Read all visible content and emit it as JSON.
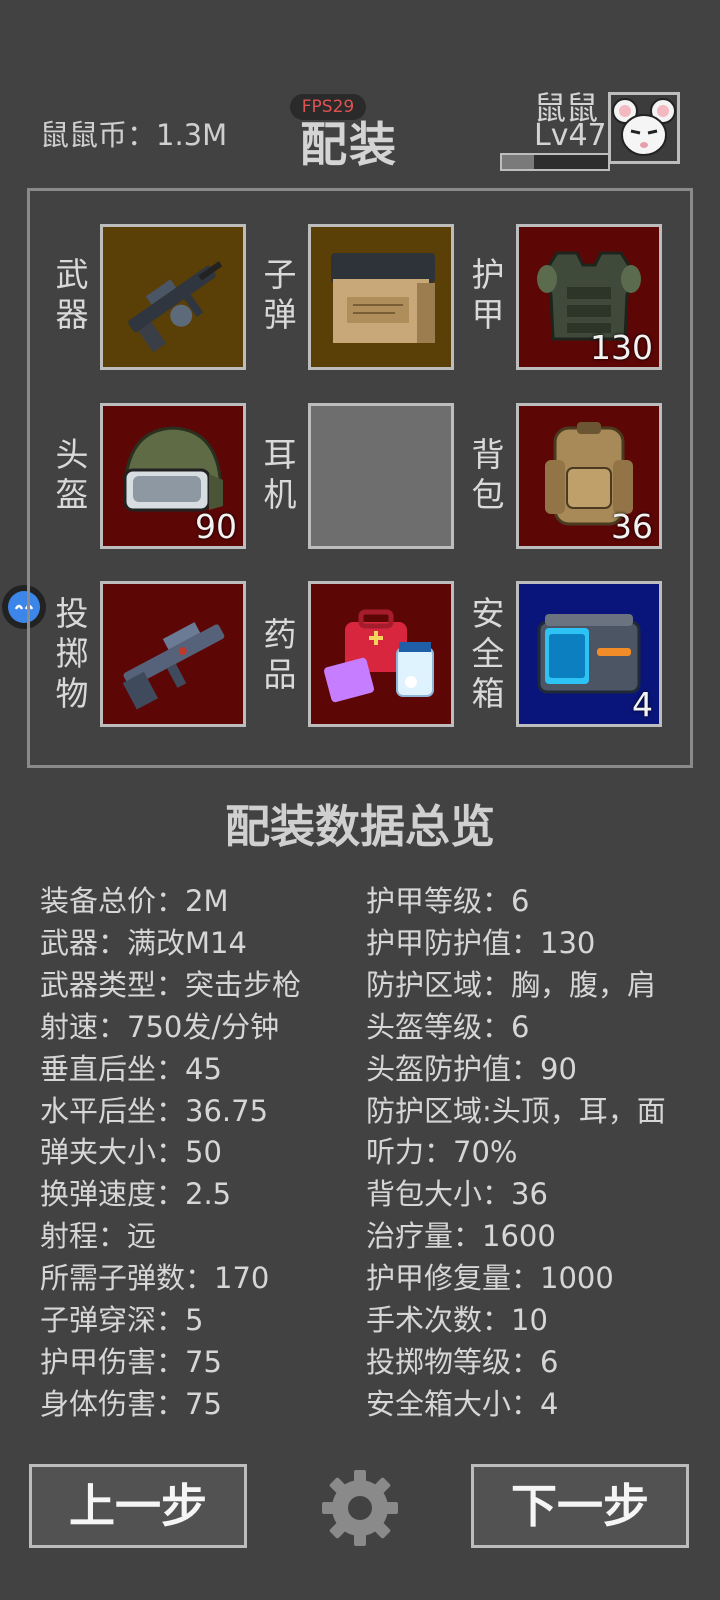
{
  "header": {
    "coins_label": "鼠鼠币：1.3M",
    "fps_label": "FPS29",
    "title": "配装",
    "user_name": "鼠鼠",
    "user_level": "Lv47",
    "xp_progress": 0.3
  },
  "slots": [
    {
      "label_chars": [
        "武",
        "器"
      ],
      "count": "",
      "bg": "#5a3f06",
      "icon": "rifle-icon"
    },
    {
      "label_chars": [
        "子",
        "弹"
      ],
      "count": "",
      "bg": "#5a3f06",
      "icon": "ammo-box-icon"
    },
    {
      "label_chars": [
        "护",
        "甲"
      ],
      "count": "130",
      "bg": "#5c0606",
      "icon": "armor-vest-icon"
    },
    {
      "label_chars": [
        "头",
        "盔"
      ],
      "count": "90",
      "bg": "#5c0606",
      "icon": "helmet-icon"
    },
    {
      "label_chars": [
        "耳",
        "机"
      ],
      "count": "",
      "bg": "#6e6e6e",
      "icon": "empty-slot"
    },
    {
      "label_chars": [
        "背",
        "包"
      ],
      "count": "36",
      "bg": "#5c0606",
      "icon": "backpack-icon"
    },
    {
      "label_chars": [
        "投",
        "掷",
        "物"
      ],
      "count": "",
      "bg": "#5c0606",
      "icon": "launcher-icon"
    },
    {
      "label_chars": [
        "药",
        "品"
      ],
      "count": "",
      "bg": "#5c0606",
      "icon": "medkit-icon"
    },
    {
      "label_chars": [
        "安",
        "全",
        "箱"
      ],
      "count": "4",
      "bg": "#09157a",
      "icon": "safe-box-icon"
    }
  ],
  "summary": {
    "title": "配装数据总览",
    "left": [
      "装备总价：2M",
      "武器：满改M14",
      "武器类型：突击步枪",
      "射速：750发/分钟",
      "垂直后坐：45",
      "水平后坐：36.75",
      "弹夹大小：50",
      "换弹速度：2.5",
      "射程：远",
      "所需子弹数：170",
      "子弹穿深：5",
      "护甲伤害：75",
      "身体伤害：75"
    ],
    "right": [
      "护甲等级：6",
      "护甲防护值：130",
      "防护区域：胸，腹，肩",
      "头盔等级：6",
      "头盔防护值：90",
      "防护区域:头顶，耳，面",
      "听力：70%",
      "背包大小：36",
      "治疗量：1600",
      "护甲修复量：1000",
      "手术次数：10",
      "投掷物等级：6",
      "安全箱大小：4"
    ]
  },
  "footer": {
    "prev_label": "上一步",
    "next_label": "下一步"
  }
}
